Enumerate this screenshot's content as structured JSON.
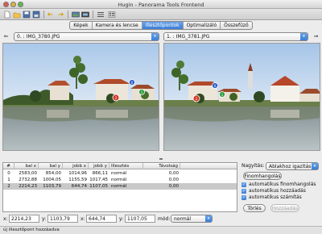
{
  "window": {
    "title": "Hugin - Panorama Tools Frontend"
  },
  "toolbar": {
    "icons": [
      "new-project-icon",
      "open-icon",
      "save-icon",
      "save-as-icon",
      "undo-icon",
      "redo-icon",
      "preview-icon",
      "gl-preview-icon",
      "list-icon",
      "preferences-icon"
    ]
  },
  "tabs": [
    {
      "label": "Képek",
      "active": false
    },
    {
      "label": "Kamera és lencse",
      "active": false
    },
    {
      "label": "Illesztőpontok",
      "active": true
    },
    {
      "label": "Optimalizáló",
      "active": false
    },
    {
      "label": "Összefűző",
      "active": false
    }
  ],
  "left_image": {
    "selector": "0. : IMG_3780.JPG"
  },
  "right_image": {
    "selector": "1. : IMG_3781.JPG"
  },
  "cp_table": {
    "columns": [
      "#",
      "bal x",
      "bal y",
      "jobb x",
      "jobb y",
      "Illesztés",
      "Távolság"
    ],
    "rows": [
      {
        "n": "0",
        "lx": "2583,00",
        "ly": "854,00",
        "rx": "1014,96",
        "ry": "866,11",
        "mode": "normál",
        "dist": "0,00"
      },
      {
        "n": "1",
        "lx": "2732,88",
        "ly": "1004,05",
        "rx": "1155,59",
        "ry": "1017,45",
        "mode": "normál",
        "dist": "0,00"
      },
      {
        "n": "2",
        "lx": "2214,23",
        "ly": "1103,79",
        "rx": "644,74",
        "ry": "1107,05",
        "mode": "normál",
        "dist": "0,00"
      }
    ],
    "selected_row": 2
  },
  "right_panel": {
    "zoom_label": "Nagyítás:",
    "zoom_value": "Ablakhoz igazítás",
    "fine_tune_button": "Finomhangolás",
    "checkboxes": [
      {
        "label": "automatikus finomhangolás",
        "checked": true
      },
      {
        "label": "automatikus hozzáadás",
        "checked": true
      },
      {
        "label": "automatikus számítás",
        "checked": true
      }
    ],
    "delete_button": "Törlés",
    "add_button": "Hozzáadás"
  },
  "coords": {
    "x1_label": "x:",
    "x1": "2214,23",
    "y1_label": "y:",
    "y1": "1103,79",
    "x2_label": "x:",
    "x2": "644,74",
    "y2_label": "y:",
    "y2": "1107,05",
    "mode_label": "mód:",
    "mode": "normál"
  },
  "status": {
    "text": "új illesztőpont hozzáadva"
  },
  "colors": {
    "accent": "#3c7fd7",
    "selected_row": "#c9c9c9"
  }
}
